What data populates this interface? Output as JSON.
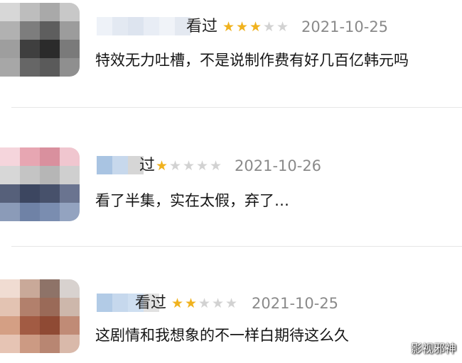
{
  "reviews": [
    {
      "name_suffix": "看过",
      "rating": 3,
      "max_rating": 5,
      "date": "2021-10-25",
      "comment": "特效无力吐槽，不是说制作费有好几百亿韩元吗"
    },
    {
      "name_suffix": "过",
      "rating": 1,
      "max_rating": 5,
      "date": "2021-10-26",
      "comment": "看了半集，实在太假，弃了…"
    },
    {
      "name_suffix": "看过",
      "rating": 2,
      "max_rating": 5,
      "date": "2021-10-25",
      "comment": "这剧情和我想象的不一样白期待这么久"
    }
  ],
  "watermark": "影视邪神",
  "colors": {
    "star_on": "#f0b21e",
    "star_off": "#d2d2d2",
    "date": "#8a8a8a"
  }
}
